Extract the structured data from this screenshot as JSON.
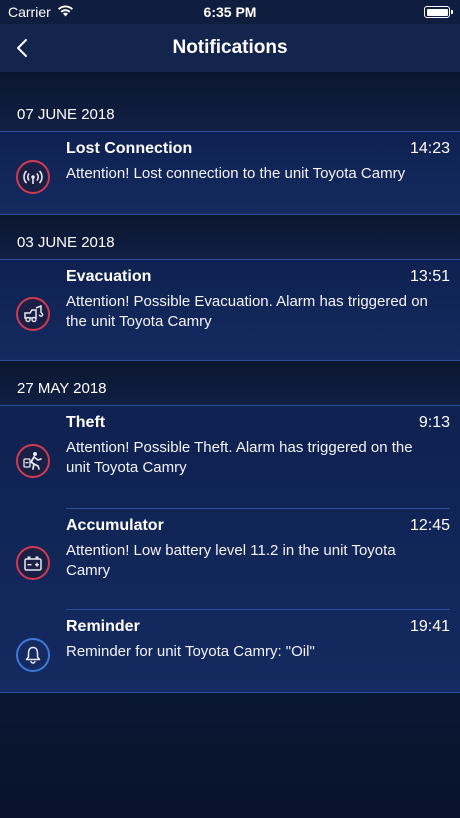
{
  "status_bar": {
    "carrier": "Carrier",
    "time": "6:35 PM"
  },
  "nav": {
    "title": "Notifications"
  },
  "colors": {
    "accent_red": "#d23a52",
    "accent_blue": "#3d7ad8",
    "divider": "#2d4f99"
  },
  "sections": [
    {
      "date": "07 JUNE 2018",
      "items": [
        {
          "title": "Lost Connection",
          "time": "14:23",
          "message": "Attention! Lost connection to the unit Toyota Camry",
          "icon": "signal-lost-icon"
        }
      ]
    },
    {
      "date": "03 JUNE 2018",
      "items": [
        {
          "title": "Evacuation",
          "time": "13:51",
          "message": "Attention! Possible Evacuation. Alarm has triggered on the unit Toyota Camry",
          "icon": "tow-truck-icon"
        }
      ]
    },
    {
      "date": "27 MAY 2018",
      "items": [
        {
          "title": "Theft",
          "time": "9:13",
          "message": "Attention! Possible Theft. Alarm has triggered on the unit Toyota Camry",
          "icon": "theft-icon"
        },
        {
          "title": "Accumulator",
          "time": "12:45",
          "message": "Attention! Low battery level 11.2 in the unit Toyota Camry",
          "icon": "battery-icon"
        },
        {
          "title": "Reminder",
          "time": "19:41",
          "message": "Reminder for unit Toyota Camry: \"Oil\"",
          "icon": "bell-icon"
        }
      ]
    }
  ]
}
